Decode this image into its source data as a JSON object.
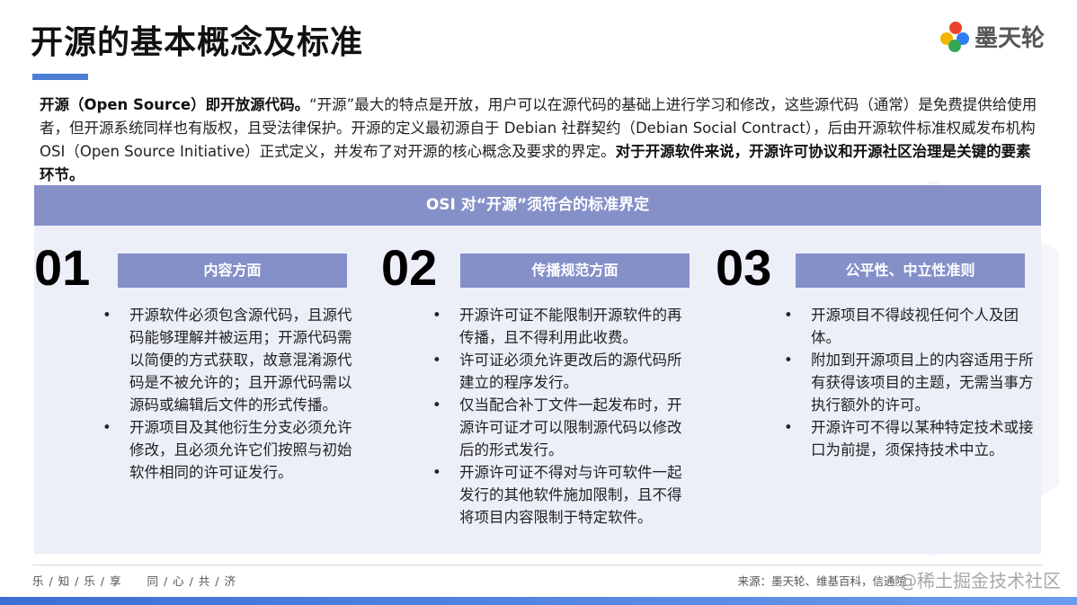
{
  "title": "开源的基本概念及标准",
  "logo_text": "墨天轮",
  "intro": {
    "bold1": "开源（Open Source）即开放源代码。",
    "text1": "“开源”最大的特点是开放，用户可以在源代码的基础上进行学习和修改，这些源代码（通常）是免费提供给使用者，但开源系统同样也有版权，且受法律保护。开源的定义最初源自于 Debian 社群契约（Debian Social Contract），后由开源软件标准权威发布机构 OSI（Open Source Initiative）正式定义，并发布了对开源的核心概念及要求的界定。",
    "bold2": "对于开源软件来说，开源许可协议和开源社区治理是关键的要素环节。"
  },
  "panel_title": "OSI 对“开源”须符合的标准界定",
  "columns": [
    {
      "num": "01",
      "heading": "内容方面",
      "items": [
        "开源软件必须包含源代码，且源代码能够理解并被运用；开源代码需以简便的方式获取，故意混淆源代码是不被允许的；且开源代码需以源码或编辑后文件的形式传播。",
        "开源项目及其他衍生分支必须允许修改，且必须允许它们按照与初始软件相同的许可证发行。"
      ]
    },
    {
      "num": "02",
      "heading": "传播规范方面",
      "items": [
        "开源许可证不能限制开源软件的再传播，且不得利用此收费。",
        "许可证必须允许更改后的源代码所建立的程序发行。",
        "仅当配合补丁文件一起发布时，开源许可证才可以限制源代码以修改后的形式发行。",
        "开源许可证不得对与许可软件一起发行的其他软件施加限制，且不得将项目内容限制于特定软件。"
      ]
    },
    {
      "num": "03",
      "heading": "公平性、中立性准则",
      "items": [
        "开源项目不得歧视任何个人及团体。",
        "附加到开源项目上的内容适用于所有获得该项目的主题，无需当事方执行额外的许可。",
        "开源许可不得以某种特定技术或接口为前提，须保持技术中立。"
      ]
    }
  ],
  "footer": {
    "left1": "乐 / 知 / 乐 / 享",
    "left2": "同 / 心 / 共 / 济",
    "source": "来源：墨天轮、维基百科，信通院",
    "watermark": "@稀土掘金技术社区"
  }
}
